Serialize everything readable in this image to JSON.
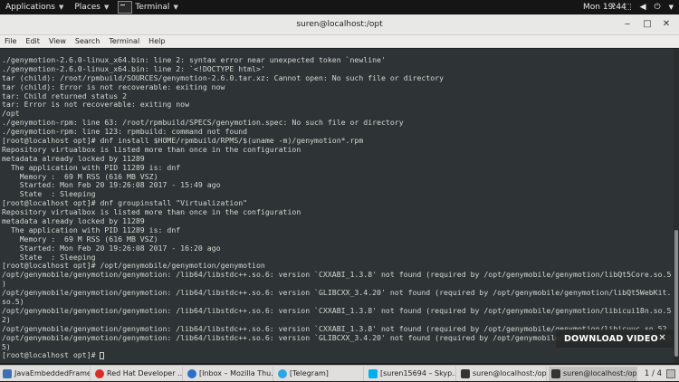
{
  "top_panel": {
    "applications": "Applications",
    "places": "Places",
    "terminal": "Terminal",
    "clock": "Mon 19:44"
  },
  "window": {
    "title": "suren@localhost:/opt",
    "menu": [
      "File",
      "Edit",
      "View",
      "Search",
      "Terminal",
      "Help"
    ]
  },
  "terminal": {
    "lines": [
      "./genymotion-2.6.0-linux_x64.bin: line 2: syntax error near unexpected token `newline'",
      "./genymotion-2.6.0-linux_x64.bin: line 2: `<!DOCTYPE html>'",
      "tar (child): /root/rpmbuild/SOURCES/genymotion-2.6.0.tar.xz: Cannot open: No such file or directory",
      "tar (child): Error is not recoverable: exiting now",
      "tar: Child returned status 2",
      "tar: Error is not recoverable: exiting now",
      "/opt",
      "./genymotion-rpm: line 63: /root/rpmbuild/SPECS/genymotion.spec: No such file or directory",
      "./genymotion-rpm: line 123: rpmbuild: command not found",
      "[root@localhost opt]# dnf install $HOME/rpmbuild/RPMS/$(uname -m)/genymotion*.rpm",
      "Repository virtualbox is listed more than once in the configuration",
      "metadata already locked by 11289",
      "  The application with PID 11289 is: dnf",
      "    Memory :  69 M RSS (616 MB VSZ)",
      "    Started: Mon Feb 20 19:26:08 2017 - 15:49 ago",
      "    State  : Sleeping",
      "[root@localhost opt]# dnf groupinstall \"Virtualization\"",
      "Repository virtualbox is listed more than once in the configuration",
      "metadata already locked by 11289",
      "  The application with PID 11289 is: dnf",
      "    Memory :  69 M RSS (616 MB VSZ)",
      "    Started: Mon Feb 20 19:26:08 2017 - 16:20 ago",
      "    State  : Sleeping",
      "[root@localhost opt]# /opt/genymobile/genymotion/genymotion",
      "/opt/genymobile/genymotion/genymotion: /lib64/libstdc++.so.6: version `CXXABI_1.3.8' not found (required by /opt/genymobile/genymotion/libQt5Core.so.5",
      ")",
      "/opt/genymobile/genymotion/genymotion: /lib64/libstdc++.so.6: version `GLIBCXX_3.4.20' not found (required by /opt/genymobile/genymotion/libQt5WebKit.",
      "so.5)",
      "/opt/genymobile/genymotion/genymotion: /lib64/libstdc++.so.6: version `CXXABI_1.3.8' not found (required by /opt/genymobile/genymotion/libicui18n.so.5",
      "2)",
      "/opt/genymobile/genymotion/genymotion: /lib64/libstdc++.so.6: version `CXXABI_1.3.8' not found (required by /opt/genymobile/genymotion/libicuuc.so.52",
      "/opt/genymobile/genymotion/genymotion: /lib64/libstdc++.so.6: version `GLIBCXX_3.4.20' not found (required by /opt/genymobile/genymotion/libicuuc.so.5",
      "5)"
    ],
    "prompt": "[root@localhost opt]# "
  },
  "overlay": {
    "label": "DOWNLOAD VIDEO",
    "close": "✕"
  },
  "taskbar": {
    "items": [
      {
        "label": "JavaEmbeddedFrame",
        "icon_color": "#3b6fb6",
        "icon": "java-window-icon"
      },
      {
        "label": "Red Hat Developer ...",
        "icon_color": "#d93025",
        "icon": "chrome-icon"
      },
      {
        "label": "[Inbox – Mozilla Thu...",
        "icon_color": "#2a6fc9",
        "icon": "thunderbird-icon"
      },
      {
        "label": "[Telegram]",
        "icon_color": "#2ca5e0",
        "icon": "telegram-icon"
      },
      {
        "label": "[suren15694 – Skyp...",
        "icon_color": "#00aff0",
        "icon": "skype-icon"
      },
      {
        "label": "suren@localhost:/opt",
        "icon_color": "#333333",
        "icon": "terminal-icon"
      },
      {
        "label": "suren@localhost:/opt",
        "icon_color": "#333333",
        "icon": "terminal-icon"
      }
    ],
    "pager": "1 / 4"
  }
}
